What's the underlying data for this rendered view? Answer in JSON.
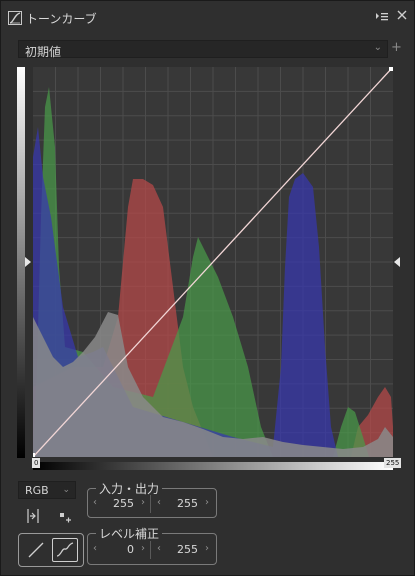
{
  "window": {
    "title": "トーンカーブ",
    "icon": "tone-curve-app-icon"
  },
  "preset": {
    "value": "初期値"
  },
  "graph": {
    "min_label": "0",
    "max_label": "255"
  },
  "channel": {
    "value": "RGB"
  },
  "input_output": {
    "label": "入力・出力",
    "input": "255",
    "output": "255"
  },
  "levels": {
    "label": "レベル補正",
    "black": "0",
    "white": "255"
  },
  "colors": {
    "red": "#c04848",
    "green": "#4f9a4f",
    "blue": "#3a3ab8",
    "gray": "#8a8a8a",
    "curve": "#f2d6d6"
  }
}
